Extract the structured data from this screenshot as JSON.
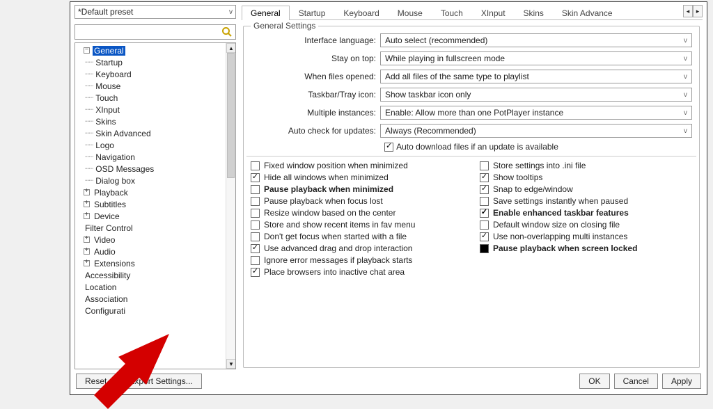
{
  "preset": {
    "label": "*Default preset"
  },
  "search": {
    "placeholder": ""
  },
  "tabs": {
    "items": [
      "General",
      "Startup",
      "Keyboard",
      "Mouse",
      "Touch",
      "XInput",
      "Skins",
      "Skin Advance"
    ],
    "active": 0,
    "scroll_left": "◂",
    "scroll_right": "▸"
  },
  "tree": {
    "nodes": [
      {
        "label": "General",
        "depth": 0,
        "expander": "-",
        "selected": true
      },
      {
        "label": "Startup",
        "depth": 1
      },
      {
        "label": "Keyboard",
        "depth": 1
      },
      {
        "label": "Mouse",
        "depth": 1
      },
      {
        "label": "Touch",
        "depth": 1
      },
      {
        "label": "XInput",
        "depth": 1
      },
      {
        "label": "Skins",
        "depth": 1
      },
      {
        "label": "Skin Advanced",
        "depth": 1
      },
      {
        "label": "Logo",
        "depth": 1
      },
      {
        "label": "Navigation",
        "depth": 1
      },
      {
        "label": "OSD Messages",
        "depth": 1
      },
      {
        "label": "Dialog box",
        "depth": 1
      },
      {
        "label": "Playback",
        "depth": 0,
        "expander": "+"
      },
      {
        "label": "Subtitles",
        "depth": 0,
        "expander": "+"
      },
      {
        "label": "Device",
        "depth": 0,
        "expander": "+"
      },
      {
        "label": "Filter Control",
        "depth": 0
      },
      {
        "label": "Video",
        "depth": 0,
        "expander": "+"
      },
      {
        "label": "Audio",
        "depth": 0,
        "expander": "+"
      },
      {
        "label": "Extensions",
        "depth": 0,
        "expander": "+"
      },
      {
        "label": "Accessibility",
        "depth": 0
      },
      {
        "label": "Location",
        "depth": 0
      },
      {
        "label": "Association",
        "depth": 0
      },
      {
        "label": "Configurati",
        "depth": 0
      }
    ]
  },
  "group": {
    "legend": "General Settings",
    "rows": [
      {
        "label": "Interface language:",
        "value": "Auto select (recommended)"
      },
      {
        "label": "Stay on top:",
        "value": "While playing in fullscreen mode"
      },
      {
        "label": "When files opened:",
        "value": "Add all files of the same type to playlist"
      },
      {
        "label": "Taskbar/Tray icon:",
        "value": "Show taskbar icon only"
      },
      {
        "label": "Multiple instances:",
        "value": "Enable: Allow more than one PotPlayer instance"
      },
      {
        "label": "Auto check for updates:",
        "value": "Always (Recommended)"
      }
    ],
    "auto_dl": {
      "checked": true,
      "label": "Auto download files if an update is available"
    }
  },
  "checks": {
    "left": [
      {
        "checked": false,
        "bold": false,
        "label": "Fixed window position when minimized"
      },
      {
        "checked": true,
        "bold": false,
        "label": "Hide all windows when minimized"
      },
      {
        "checked": false,
        "bold": true,
        "label": "Pause playback when minimized"
      },
      {
        "checked": false,
        "bold": false,
        "label": "Pause playback when focus lost"
      },
      {
        "checked": false,
        "bold": false,
        "label": "Resize window based on the center"
      },
      {
        "checked": false,
        "bold": false,
        "label": "Store and show recent items in fav menu"
      },
      {
        "checked": false,
        "bold": false,
        "label": "Don't get focus when started with a file"
      },
      {
        "checked": true,
        "bold": false,
        "label": "Use advanced drag and drop interaction"
      },
      {
        "checked": false,
        "bold": false,
        "label": "Ignore error messages if playback starts"
      },
      {
        "checked": true,
        "bold": false,
        "label": "Place browsers into inactive chat area"
      }
    ],
    "right": [
      {
        "checked": false,
        "bold": false,
        "label": "Store settings into .ini file"
      },
      {
        "checked": true,
        "bold": false,
        "label": "Show tooltips"
      },
      {
        "checked": true,
        "bold": false,
        "label": "Snap to edge/window"
      },
      {
        "checked": false,
        "bold": false,
        "label": "Save settings instantly when paused"
      },
      {
        "checked": true,
        "bold": true,
        "label": "Enable enhanced taskbar features"
      },
      {
        "checked": false,
        "bold": false,
        "label": "Default window size on closing file"
      },
      {
        "checked": true,
        "bold": false,
        "label": "Use non-overlapping multi instances"
      },
      {
        "checked": "mixed",
        "bold": true,
        "label": "Pause playback when screen locked"
      }
    ]
  },
  "footer": {
    "reset": "Reset",
    "export": "Export Settings...",
    "ok": "OK",
    "cancel": "Cancel",
    "apply": "Apply"
  },
  "icons": {
    "search": "🔍",
    "caret": "v"
  }
}
